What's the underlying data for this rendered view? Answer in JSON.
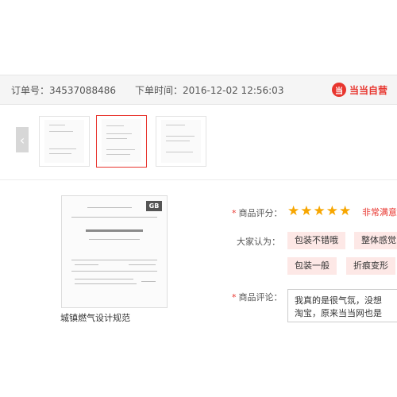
{
  "order": {
    "number": "订单号：34537088486",
    "time": "下单时间：2016-12-02 12:56:03"
  },
  "brand": {
    "logo_text": "当",
    "name": "当当自营"
  },
  "icons": {
    "prev_arrow": "chevron-left-icon",
    "star": "star-icon"
  },
  "product": {
    "name": "城镇燃气设计规范",
    "cover_badge": "GB"
  },
  "review": {
    "rating_label": "商品评分：",
    "rating_text": "非常满意",
    "rating_stars": 5,
    "opinion_label": "大家认为：",
    "tags": [
      "包装不错哦",
      "整体感觉",
      "包装一般",
      "折痕变形"
    ],
    "comment_label": "商品评论：",
    "comment_lines": [
      "我真的是很气氛，没想",
      "淘宝，原来当当网也是"
    ]
  },
  "colors": {
    "accent": "#e8362f",
    "star": "#f7a600",
    "tag_bg": "#fde8e6"
  }
}
